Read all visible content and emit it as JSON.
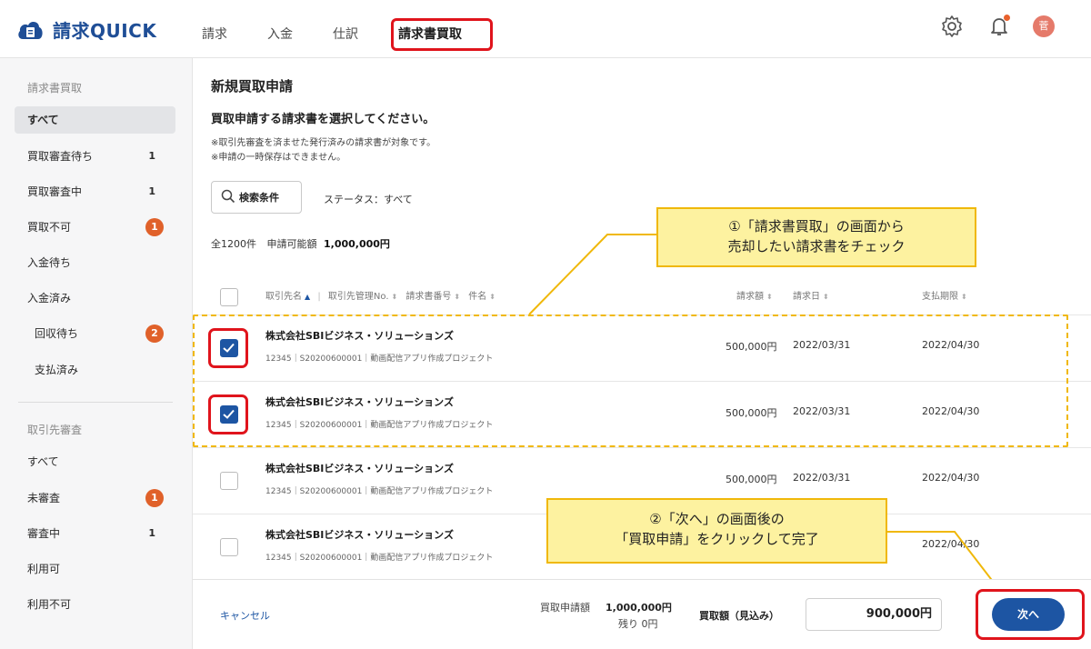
{
  "app": {
    "name": "請求QUICK"
  },
  "nav": {
    "tabs": [
      "請求",
      "入金",
      "仕訳",
      "請求書買取"
    ],
    "active_index": 3
  },
  "header": {
    "avatar_text": "菅"
  },
  "sidebar": {
    "section1_title": "請求書買取",
    "section1_items": [
      {
        "label": "すべて",
        "count": "",
        "badge": ""
      },
      {
        "label": "買取審査待ち",
        "count": "1",
        "badge": ""
      },
      {
        "label": "買取審査中",
        "count": "1",
        "badge": ""
      },
      {
        "label": "買取不可",
        "count": "",
        "badge": "1"
      },
      {
        "label": "入金待ち",
        "count": "",
        "badge": ""
      },
      {
        "label": "入金済み",
        "count": "",
        "badge": ""
      },
      {
        "label": "回収待ち",
        "count": "",
        "badge": "2"
      },
      {
        "label": "支払済み",
        "count": "",
        "badge": ""
      }
    ],
    "section2_title": "取引先審査",
    "section2_items": [
      {
        "label": "すべて",
        "count": "",
        "badge": ""
      },
      {
        "label": "未審査",
        "count": "",
        "badge": "1"
      },
      {
        "label": "審査中",
        "count": "1",
        "badge": ""
      },
      {
        "label": "利用可",
        "count": "",
        "badge": ""
      },
      {
        "label": "利用不可",
        "count": "",
        "badge": ""
      }
    ]
  },
  "main": {
    "title": "新規買取申請",
    "subtitle": "買取申請する請求書を選択してください。",
    "notes": [
      "※取引先審査を済ませた発行済みの請求書が対象です。",
      "※申請の一時保存はできません。"
    ],
    "search_label": "検索条件",
    "status_filter": "ステータス：すべて",
    "total_label": "全1200件",
    "available_label": "申請可能額",
    "available_value": "1,000,000円"
  },
  "table": {
    "headers": {
      "client": "取引先名",
      "client_no": "取引先管理No.",
      "invoice_no": "請求書番号",
      "subject": "件名",
      "amount": "請求額",
      "date": "請求日",
      "due": "支払期限"
    },
    "rows": [
      {
        "name": "株式会社SBIビジネス・ソリューションズ",
        "meta": "12345｜S20200600001｜動画配信アプリ作成プロジェクト",
        "amount": "500,000円",
        "date": "2022/03/31",
        "due": "2022/04/30",
        "checked": true
      },
      {
        "name": "株式会社SBIビジネス・ソリューションズ",
        "meta": "12345｜S20200600001｜動画配信アプリ作成プロジェクト",
        "amount": "500,000円",
        "date": "2022/03/31",
        "due": "2022/04/30",
        "checked": true
      },
      {
        "name": "株式会社SBIビジネス・ソリューションズ",
        "meta": "12345｜S20200600001｜動画配信アプリ作成プロジェクト",
        "amount": "500,000円",
        "date": "2022/03/31",
        "due": "2022/04/30",
        "checked": false
      },
      {
        "name": "株式会社SBIビジネス・ソリューションズ",
        "meta": "12345｜S20200600001｜動画配信アプリ作成プロジェクト",
        "amount": "",
        "date": "",
        "due": "2022/04/30",
        "checked": false
      }
    ]
  },
  "footer": {
    "cancel": "キャンセル",
    "applied_label": "買取申請額",
    "applied_value": "1,000,000円",
    "remaining": "残り 0円",
    "estimate_label": "買取額（見込み）",
    "estimate_value": "900,000円",
    "next": "次へ"
  },
  "callouts": {
    "one_line1": "①「請求書買取」の画面から",
    "one_line2": "売却したい請求書をチェック",
    "two_line1": "②「次へ」の画面後の",
    "two_line2": "「買取申請」をクリックして完了"
  },
  "colors": {
    "brand": "#1f4e96",
    "primary": "#1d55a3",
    "badge": "#e0612a",
    "highlight_red": "#e0141c",
    "callout_fill": "#fdf2a0",
    "callout_border": "#f0b80a"
  }
}
